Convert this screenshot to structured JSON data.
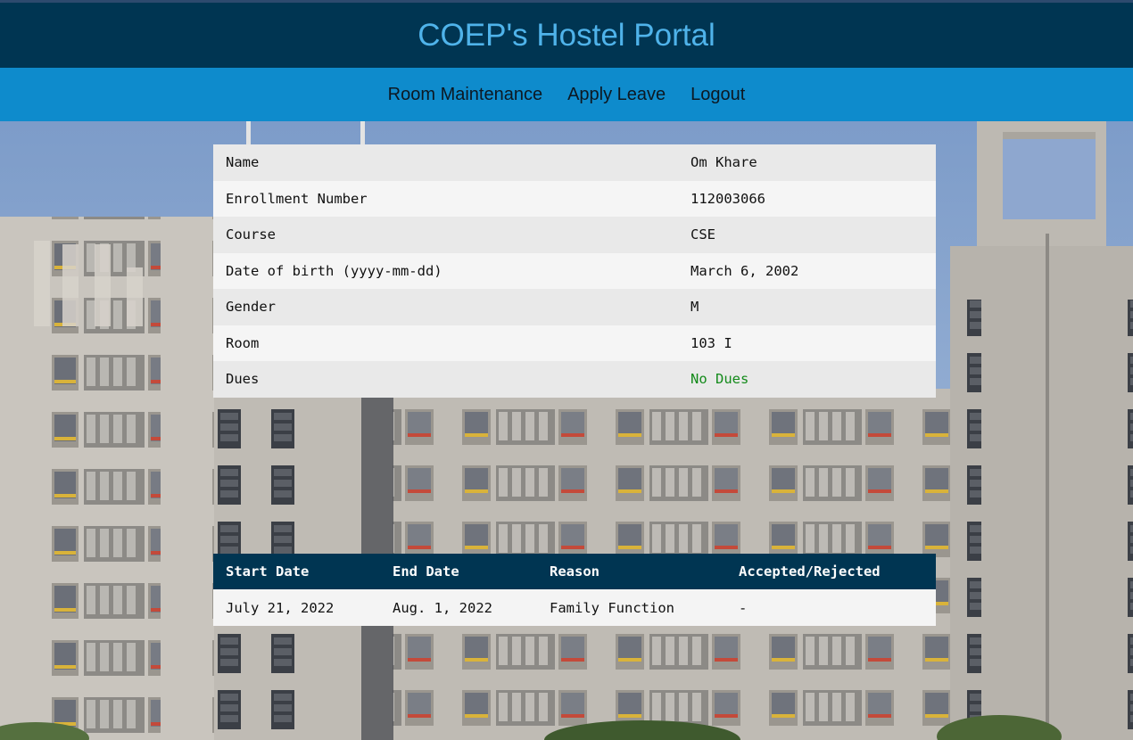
{
  "header": {
    "title": "COEP's Hostel Portal"
  },
  "nav": {
    "items": [
      {
        "label": "Room Maintenance"
      },
      {
        "label": "Apply Leave"
      },
      {
        "label": "Logout"
      }
    ]
  },
  "student": {
    "rows": [
      {
        "label": "Name",
        "value": "Om Khare"
      },
      {
        "label": "Enrollment Number",
        "value": "112003066"
      },
      {
        "label": "Course",
        "value": "CSE"
      },
      {
        "label": "Date of birth (yyyy-mm-dd)",
        "value": "March 6, 2002"
      },
      {
        "label": "Gender",
        "value": "M"
      },
      {
        "label": "Room",
        "value": "103 I"
      },
      {
        "label": "Dues",
        "value": "No Dues"
      }
    ]
  },
  "leaves": {
    "headers": [
      "Start Date",
      "End Date",
      "Reason",
      "Accepted/Rejected"
    ],
    "rows": [
      [
        "July 21, 2022",
        "Aug. 1, 2022",
        "Family Function",
        "-"
      ]
    ]
  },
  "colors": {
    "title_bar": "#003552",
    "title_text": "#4fb3ea",
    "navbar": "#0e8bcc",
    "dues_ok": "#138a1a"
  }
}
